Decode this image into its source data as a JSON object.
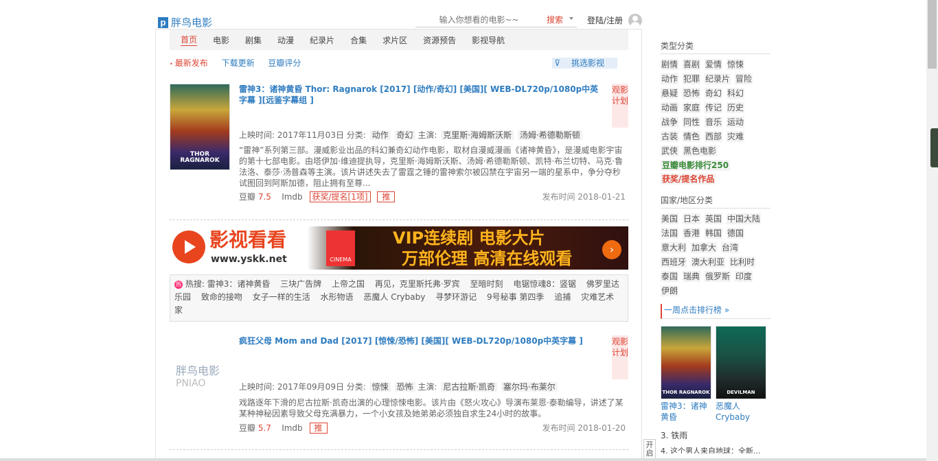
{
  "header": {
    "logo_mark": "p",
    "logo_text": "胖鸟电影",
    "search_placeholder": "输入你想看的电影~~",
    "search_button": "搜索",
    "login_text": "登陆/注册"
  },
  "nav": {
    "items": [
      "首页",
      "电影",
      "剧集",
      "动漫",
      "纪录片",
      "合集",
      "求片区",
      "资源预告",
      "影视导航"
    ]
  },
  "subnav": {
    "items": [
      "最新发布",
      "下载更新",
      "豆瓣评分"
    ],
    "filter_label": "挑选影视"
  },
  "movies": [
    {
      "title": "雷神3：诸神黄昏  Thor: Ragnarok  [2017]  [动作/奇幻]  [美国][ WEB-DL720p/1080p中英字幕 ][远鉴字幕组 ]",
      "plan_label": "观影计划",
      "release_label": "上映时间:",
      "release_date": "2017年11月03日",
      "genre_label": "分类:",
      "genres": [
        "动作",
        "奇幻"
      ],
      "cast_label": "主演:",
      "cast": [
        "克里斯·海姆斯沃斯",
        "汤姆·希德勒斯顿"
      ],
      "desc": "“雷神”系列第三部。漫威影业出品的科幻兼奇幻动作电影，取材自漫威漫画《诸神黄昏》，是漫威电影宇宙的第十七部电影。由塔伊加·维迪提执导，克里斯·海姆斯沃斯、汤姆·希德勒斯顿、凯特·布兰切特、马克·鲁法洛、泰莎·汤普森等主演。该片讲述失去了雷霆之锤的雷神索尔被囚禁在宇宙另一端的星系中，争分夺秒试图回到阿斯加德，阻止拥有至尊...",
      "douban_label": "豆瓣",
      "douban_score": "7.5",
      "imdb_label": "Imdb",
      "award_label": "获奖/提名[1项]",
      "push_label": "推",
      "publish_label": "发布时间 2018-01-21",
      "poster_text": "THOR RAGNAROK"
    },
    {
      "title": "疯狂父母  Mom and Dad  [2017]  [惊悚/恐怖]  [美国][ WEB-DL720p/1080p中英字幕 ]",
      "plan_label": "观影计划",
      "release_label": "上映时间:",
      "release_date": "2017年09月09日",
      "genre_label": "分类:",
      "genres": [
        "惊悚",
        "恐怖"
      ],
      "cast_label": "主演:",
      "cast": [
        "尼古拉斯·凯奇",
        "塞尔玛·布莱尔"
      ],
      "desc": "戏路逐年下滑的尼古拉斯·凯奇出演的心理惊悚电影。该片由《怒火攻心》导演布莱恩·泰勒编导，讲述了某某种神秘因素导致父母充满暴力，一个小女孩及她弟弟必须独自求生24小时的故事。",
      "douban_label": "豆瓣",
      "douban_score": "5.7",
      "imdb_label": "Imdb",
      "push_label": "推",
      "publish_label": "发布时间 2018-01-20",
      "poster_placeholder_1": "胖鸟电影",
      "poster_placeholder_2": "PNIAO"
    }
  ],
  "banner": {
    "brand": "影视看看",
    "url": "www.yskk.net",
    "cinema": "CINEMA",
    "line1": "VIP连续剧 电影大片",
    "line2": "万部伦理 高清在线观看",
    "arrow": "›"
  },
  "hot": {
    "label": "热搜:",
    "icon": "热",
    "keywords": [
      "雷神3：诸神黄昏",
      "三块广告牌",
      "上帝之国",
      "再见，克里斯托弗·罗宾",
      "至暗时刻",
      "电锯惊魂8：竖锯",
      "佛罗里达乐园",
      "致命的接吻",
      "女子一样的生活",
      "水形物语",
      "恶魔人 Crybaby",
      "寻梦环游记",
      "9号秘事 第四季",
      "追捕",
      "灾难艺术家"
    ]
  },
  "sidebar": {
    "type_title": "类型分类",
    "types": [
      "剧情",
      "喜剧",
      "爱情",
      "惊悚",
      "动作",
      "犯罪",
      "纪录片",
      "冒险",
      "悬疑",
      "恐怖",
      "奇幻",
      "科幻",
      "动画",
      "家庭",
      "传记",
      "历史",
      "战争",
      "同性",
      "音乐",
      "运动",
      "古装",
      "情色",
      "西部",
      "灾难",
      "武侠",
      "黑色电影"
    ],
    "douban_top": "豆瓣电影排行250",
    "awards": "获奖/提名作品",
    "region_title": "国家/地区分类",
    "regions": [
      "美国",
      "日本",
      "英国",
      "中国大陆",
      "法国",
      "香港",
      "韩国",
      "德国",
      "意大利",
      "加拿大",
      "台湾",
      "西班牙",
      "澳大利亚",
      "比利时",
      "泰国",
      "瑞典",
      "俄罗斯",
      "印度",
      "伊朗"
    ],
    "rank_title": "一周点击排行榜 »",
    "rank_items": [
      {
        "caption": "雷神3：诸神黄昏",
        "poster_text": "THOR RAGNAROK"
      },
      {
        "caption": "恶魔人 Crybaby",
        "poster_text": "DEVILMAN"
      }
    ],
    "rank_3": "3. 铁雨",
    "rank_4": "4. 这个男人来自地球：全新..."
  },
  "toggle_label": "开启",
  "colors": {
    "accent_red": "#dd4433",
    "link_blue": "#2e7cc0",
    "douban_green": "#3a8a3a"
  }
}
